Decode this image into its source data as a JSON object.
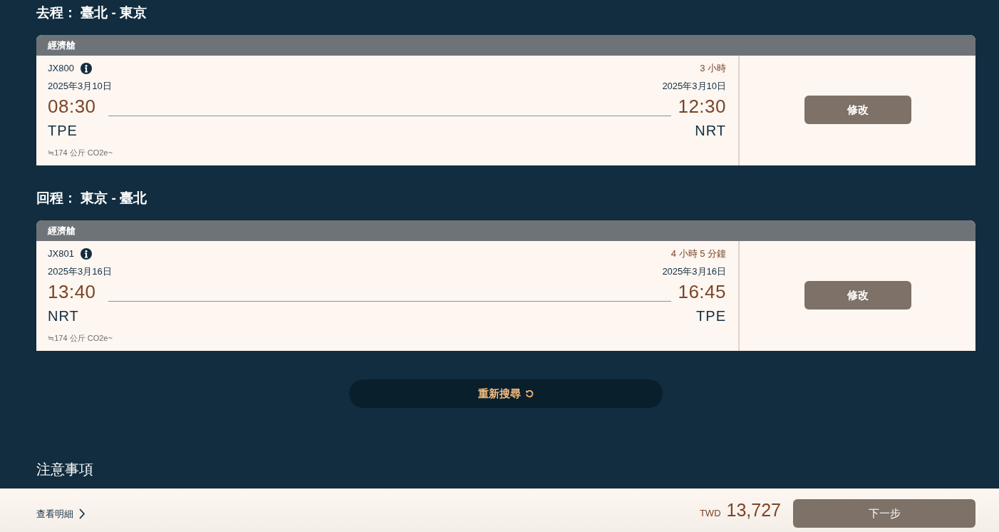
{
  "legs": [
    {
      "heading": "去程： 臺北 - 東京",
      "cabin": "經濟艙",
      "flight_number": "JX800",
      "duration": "3 小時",
      "departure": {
        "date": "2025年3月10日",
        "time": "08:30",
        "airport": "TPE"
      },
      "arrival": {
        "date": "2025年3月10日",
        "time": "12:30",
        "airport": "NRT"
      },
      "emissions": "≒174 公斤 CO2e~",
      "action": "修改"
    },
    {
      "heading": "回程： 東京 - 臺北",
      "cabin": "經濟艙",
      "flight_number": "JX801",
      "duration": "4 小時 5 分鐘",
      "departure": {
        "date": "2025年3月16日",
        "time": "13:40",
        "airport": "NRT"
      },
      "arrival": {
        "date": "2025年3月16日",
        "time": "16:45",
        "airport": "TPE"
      },
      "emissions": "≒174 公斤 CO2e~",
      "action": "修改"
    }
  ],
  "research_button": "重新搜尋",
  "notice_heading": "注意事項",
  "footer": {
    "details_link": "查看明細",
    "currency": "TWD",
    "total": "13,727",
    "next_button": "下一步"
  }
}
